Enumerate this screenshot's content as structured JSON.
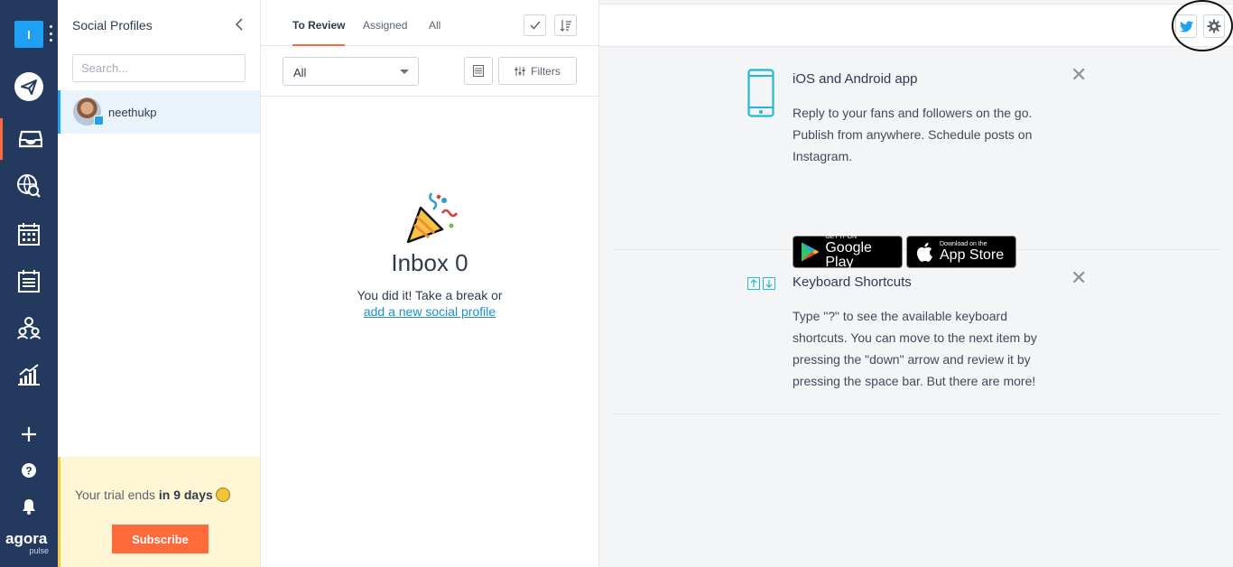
{
  "workspace": {
    "initial": "I"
  },
  "brand": {
    "line1": "agora",
    "line2": "pulse"
  },
  "rail": {
    "items": [
      {
        "icon": "publish-plane-icon"
      },
      {
        "icon": "inbox-icon"
      },
      {
        "icon": "listening-globe-icon"
      },
      {
        "icon": "calendar-icon"
      },
      {
        "icon": "content-list-icon"
      },
      {
        "icon": "team-icon"
      },
      {
        "icon": "reports-icon"
      }
    ],
    "bottom": [
      {
        "icon": "add-icon"
      },
      {
        "icon": "help-icon"
      },
      {
        "icon": "bell-icon"
      }
    ]
  },
  "profiles": {
    "title": "Social Profiles",
    "search_placeholder": "Search...",
    "items": [
      {
        "name": "neethukp",
        "network": "twitter"
      }
    ]
  },
  "trial": {
    "prefix": "Your trial ends ",
    "emphasis": "in 9 days",
    "button": "Subscribe"
  },
  "inbox": {
    "tabs": [
      "To Review",
      "Assigned",
      "All"
    ],
    "filter_value": "All",
    "filters_label": "Filters",
    "empty_title": "Inbox 0",
    "empty_text": "You did it! Take a break or",
    "empty_link": "add a new social profile"
  },
  "cards": {
    "app": {
      "title": "iOS and Android app",
      "body": "Reply to your fans and followers on the go. Publish from anywhere. Schedule posts on Instagram.",
      "google_small": "GET IT ON",
      "google_big": "Google Play",
      "apple_small": "Download on the",
      "apple_big": "App Store"
    },
    "shortcuts": {
      "title": "Keyboard Shortcuts",
      "body": "Type \"?\" to see the available keyboard shortcuts. You can move to the next item by pressing the \"down\" arrow and review it by pressing the space bar. But there are more!"
    }
  },
  "colors": {
    "rail": "#23395d",
    "accent": "#ff6a3d",
    "twitter": "#1ea1f2",
    "link": "#1a8fd8"
  }
}
